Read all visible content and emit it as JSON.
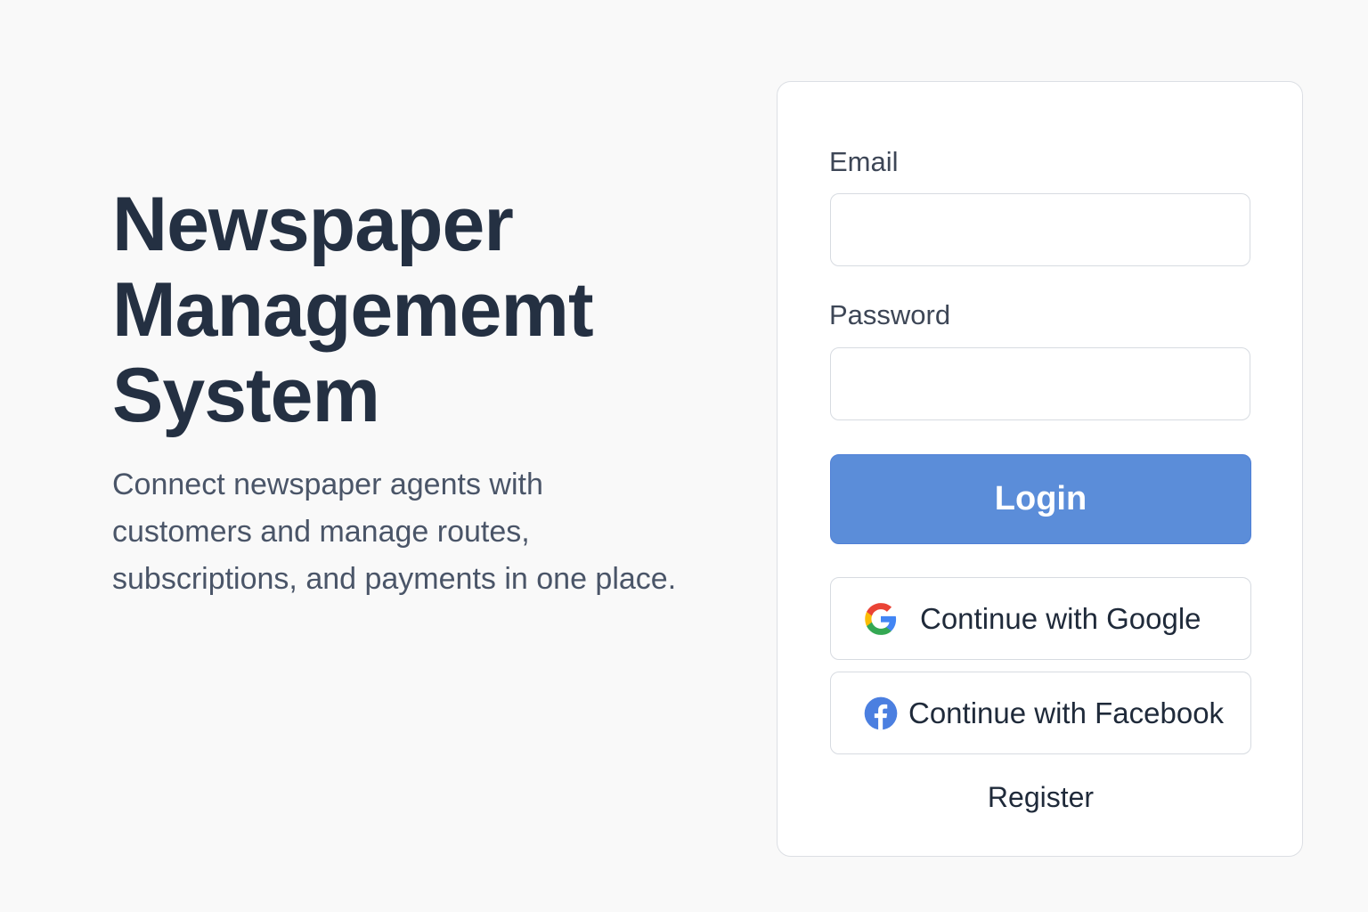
{
  "hero": {
    "title_lines": [
      "Newspaper",
      "Managememt",
      "System"
    ],
    "description": "Connect newspaper agents with\ncustomers and manage routes,\nsubscriptions, and payments in  one place."
  },
  "login_form": {
    "email": {
      "label": "Email",
      "value": "",
      "placeholder": ""
    },
    "password": {
      "label": "Password",
      "value": "",
      "placeholder": ""
    },
    "login_label": "Login",
    "google_label": "Continue with Google",
    "facebook_label": "Continue with Facebook",
    "register_label": "Register"
  },
  "icons": {
    "google": "google-icon",
    "facebook": "facebook-icon"
  },
  "colors": {
    "background": "#f9f9f9",
    "title": "#243042",
    "login_button": "#5b8dd9",
    "facebook_blue": "#4b7fe0",
    "google_blue": "#4285f4",
    "google_red": "#ea4335",
    "google_yellow": "#fbbc05",
    "google_green": "#34a853"
  }
}
